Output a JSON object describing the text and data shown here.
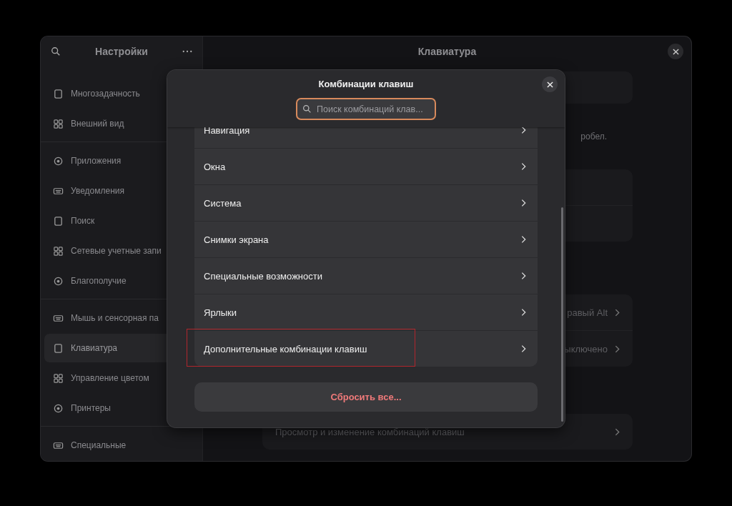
{
  "sidebar": {
    "title": "Настройки",
    "sections": [
      [
        {
          "label": "Многозадачность",
          "selected": false
        },
        {
          "label": "Внешний вид",
          "selected": false
        }
      ],
      [
        {
          "label": "Приложения",
          "selected": false
        },
        {
          "label": "Уведомления",
          "selected": false
        },
        {
          "label": "Поиск",
          "selected": false
        },
        {
          "label": "Сетевые учетные запи",
          "selected": false
        },
        {
          "label": "Благополучие",
          "selected": false
        }
      ],
      [
        {
          "label": "Мышь и сенсорная па",
          "selected": false
        },
        {
          "label": "Клавиатура",
          "selected": true
        },
        {
          "label": "Управление цветом",
          "selected": false
        },
        {
          "label": "Принтеры",
          "selected": false
        }
      ],
      [
        {
          "label": "Специальные",
          "selected": false
        }
      ]
    ]
  },
  "main": {
    "title": "Клавиатура",
    "note": "робел.",
    "cards": [
      {
        "rows": [
          {
            "kind": "blank"
          }
        ]
      },
      {
        "rows": [
          {
            "kind": "blank"
          },
          {
            "kind": "blank"
          }
        ]
      },
      {
        "rows": [
          {
            "kind": "value",
            "value": "равый Alt"
          },
          {
            "kind": "value",
            "value": "ыключено"
          }
        ]
      },
      {
        "rows": [
          {
            "kind": "link",
            "label": "Просмотр и изменение комбинаций клавиш"
          }
        ]
      }
    ]
  },
  "dialog": {
    "title": "Комбинации клавиш",
    "search": {
      "placeholder": "Поиск комбинаций клав..."
    },
    "rows": [
      {
        "label": "Навигация",
        "highlighted": false
      },
      {
        "label": "Окна",
        "highlighted": false
      },
      {
        "label": "Система",
        "highlighted": false
      },
      {
        "label": "Снимки экрана",
        "highlighted": false
      },
      {
        "label": "Специальные возможности",
        "highlighted": false
      },
      {
        "label": "Ярлыки",
        "highlighted": false
      },
      {
        "label": "Дополнительные комбинации клавиш",
        "highlighted": true
      }
    ],
    "reset_button": "Сбросить все..."
  }
}
